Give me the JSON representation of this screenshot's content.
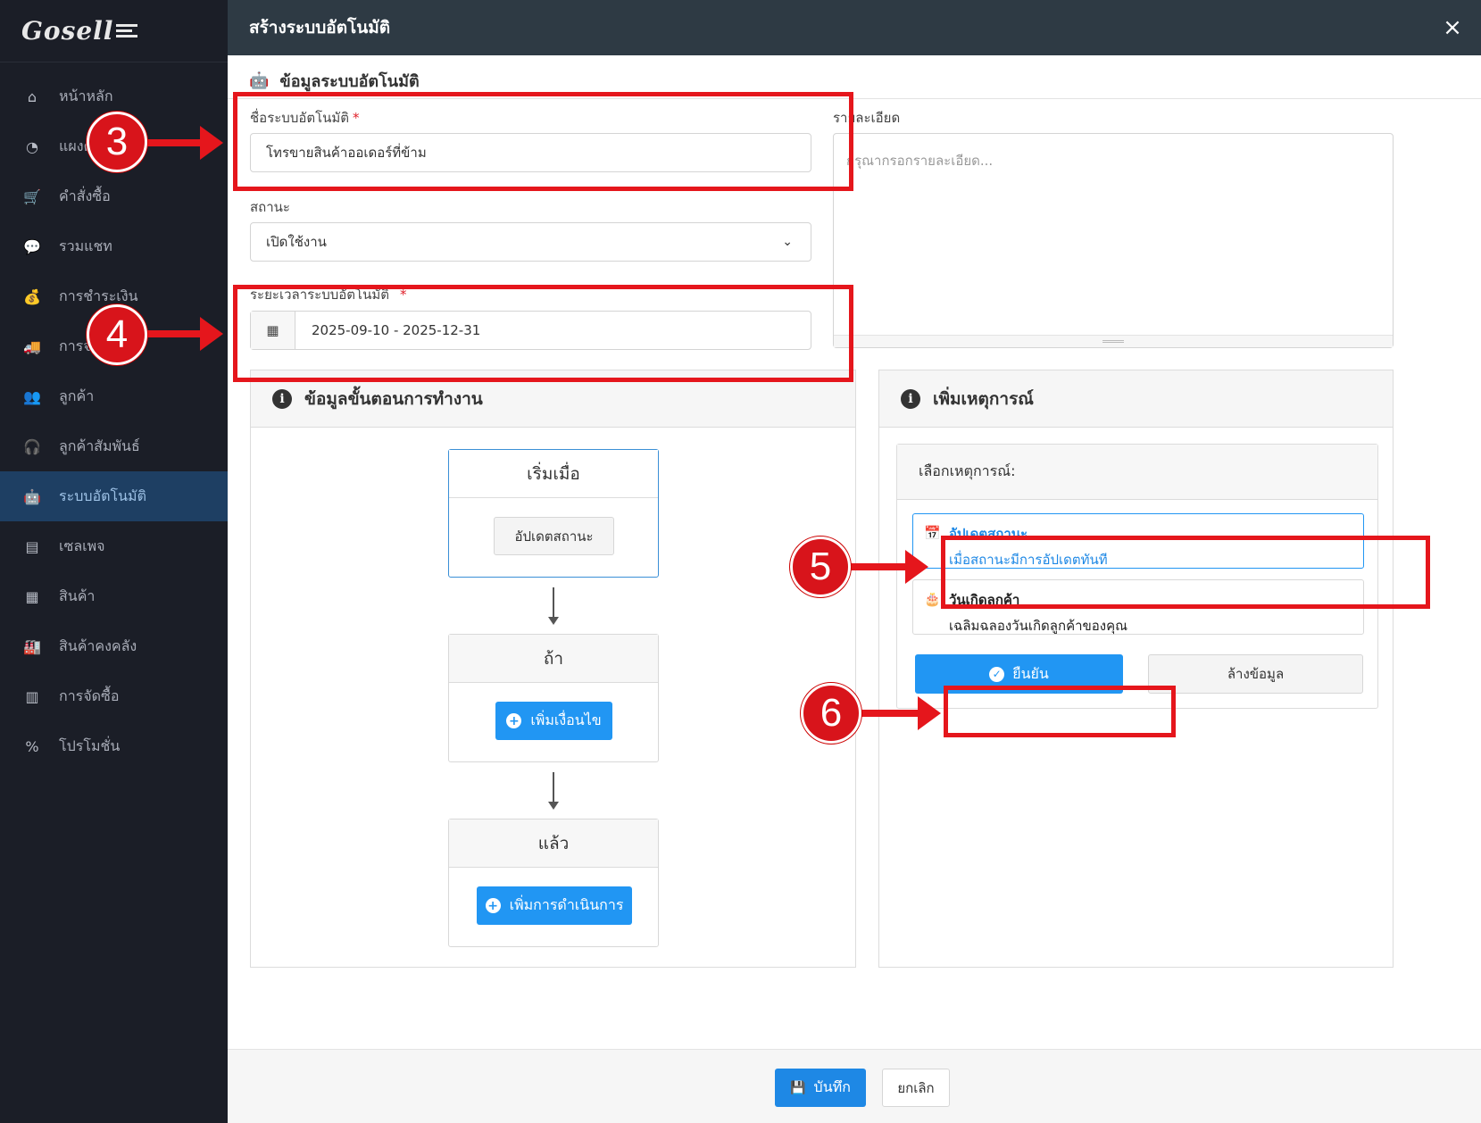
{
  "app": {
    "logo": "Gosell"
  },
  "sidebar": {
    "items": [
      {
        "label": "หน้าหลัก",
        "icon": "home-icon",
        "glyph": "⌂"
      },
      {
        "label": "แผงค",
        "icon": "dashboard-icon",
        "glyph": "◔"
      },
      {
        "label": "คำสั่งซื้อ",
        "icon": "cart-icon",
        "glyph": "🛒"
      },
      {
        "label": "รวมแชท",
        "icon": "chat-icon",
        "glyph": "💬"
      },
      {
        "label": "การชำระเงิน",
        "icon": "money-bag-icon",
        "glyph": "💰"
      },
      {
        "label": "การจั",
        "icon": "truck-icon",
        "glyph": "🚚"
      },
      {
        "label": "ลูกค้า",
        "icon": "users-icon",
        "glyph": "👥"
      },
      {
        "label": "ลูกค้าสัมพันธ์",
        "icon": "headset-icon",
        "glyph": "🎧"
      },
      {
        "label": "ระบบอัตโนมัติ",
        "icon": "robot-icon",
        "glyph": "🤖",
        "active": true
      },
      {
        "label": "เซลเพจ",
        "icon": "window-icon",
        "glyph": "▤"
      },
      {
        "label": "สินค้า",
        "icon": "boxes-icon",
        "glyph": "▦"
      },
      {
        "label": "สินค้าคงคลัง",
        "icon": "warehouse-icon",
        "glyph": "🏭"
      },
      {
        "label": "การจัดซื้อ",
        "icon": "pallet-icon",
        "glyph": "▥"
      },
      {
        "label": "โปรโมชั่น",
        "icon": "percent-icon",
        "glyph": "%"
      }
    ]
  },
  "modal": {
    "title": "สร้างระบบอัตโนมัติ",
    "close": "×",
    "section_title": "ข้อมูลระบบอัตโนมัติ",
    "form": {
      "name_label": "ชื่อระบบอัตโนมัติ",
      "required_mark": "*",
      "name_value": "โทรขายสินค้าออเดอร์ที่ข้าม",
      "status_label": "สถานะ",
      "status_value": "เปิดใช้งาน",
      "period_label": "ระยะเวลาระบบอัตโนมัติ",
      "period_value": "2025-09-10 - 2025-12-31",
      "detail_label": "รายละเอียด",
      "detail_placeholder": "กรุณากรอกรายละเอียด..."
    },
    "workflow": {
      "title": "ข้อมูลขั้นตอนการทำงาน",
      "start_title": "เริ่มเมื่อ",
      "start_button": "อัปเดตสถานะ",
      "if_title": "ถ้า",
      "if_button": "เพิ่มเงื่อนไข",
      "then_title": "แล้ว",
      "then_button": "เพิ่มการดำเนินการ"
    },
    "events": {
      "title": "เพิ่มเหตุการณ์",
      "select_label": "เลือกเหตุการณ์:",
      "items": [
        {
          "title": "อัปเดตสถานะ",
          "desc": "เมื่อสถานะมีการอัปเดตทันที",
          "selected": true
        },
        {
          "title": "วันเกิดลูกค้า",
          "desc": "เฉลิมฉลองวันเกิดลูกค้าของคุณ",
          "selected": false
        }
      ],
      "confirm": "ยืนยัน",
      "clear": "ล้างข้อมูล"
    },
    "footer": {
      "save": "บันทึก",
      "cancel": "ยกเลิก"
    }
  },
  "annotations": [
    "3",
    "4",
    "5",
    "6"
  ],
  "colors": {
    "accent": "#2196f3",
    "highlight": "#e5161c",
    "sidebar_bg": "#1b1e27",
    "sidebar_active": "#1e3f63",
    "header_bg": "#2e3a44"
  }
}
